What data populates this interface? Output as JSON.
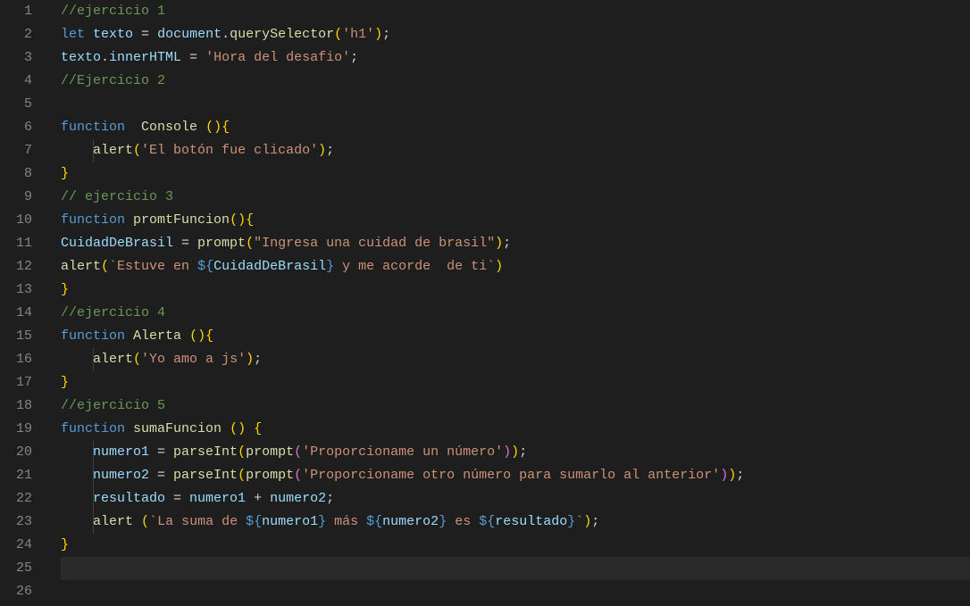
{
  "editor": {
    "lineCount": 26,
    "activeLine": 25,
    "tokens": {
      "l1": [
        [
          "comment",
          "//ejercicio 1"
        ]
      ],
      "l2": [
        [
          "keyword",
          "let"
        ],
        [
          "",
          ""
        ],
        [
          "op",
          " "
        ],
        [
          "var",
          "texto"
        ],
        [
          "op",
          " = "
        ],
        [
          "var",
          "document"
        ],
        [
          "punc",
          "."
        ],
        [
          "func",
          "querySelector"
        ],
        [
          "brace",
          "("
        ],
        [
          "string",
          "'h1'"
        ],
        [
          "brace",
          ")"
        ],
        [
          "punc",
          ";"
        ]
      ],
      "l3": [
        [
          "var",
          "texto"
        ],
        [
          "punc",
          "."
        ],
        [
          "prop",
          "innerHTML"
        ],
        [
          "op",
          " = "
        ],
        [
          "string",
          "'Hora del desafio'"
        ],
        [
          "punc",
          ";"
        ]
      ],
      "l4": [
        [
          "comment",
          "//Ejercicio 2"
        ]
      ],
      "l5": [],
      "l6": [
        [
          "keyword",
          "function"
        ],
        [
          "op",
          "  "
        ],
        [
          "func",
          "Console"
        ],
        [
          "op",
          " "
        ],
        [
          "brace",
          "()"
        ],
        [
          "brace",
          "{"
        ]
      ],
      "l7": [
        [
          "op",
          "    "
        ],
        [
          "func",
          "alert"
        ],
        [
          "brace",
          "("
        ],
        [
          "string",
          "'El botón fue clicado'"
        ],
        [
          "brace",
          ")"
        ],
        [
          "punc",
          ";"
        ]
      ],
      "l8": [
        [
          "brace",
          "}"
        ]
      ],
      "l9": [
        [
          "comment",
          "// ejercicio 3"
        ]
      ],
      "l10": [
        [
          "keyword",
          "function"
        ],
        [
          "op",
          " "
        ],
        [
          "func",
          "promtFuncion"
        ],
        [
          "brace",
          "()"
        ],
        [
          "brace",
          "{"
        ]
      ],
      "l11": [
        [
          "var",
          "CuidadDeBrasil"
        ],
        [
          "op",
          " = "
        ],
        [
          "func",
          "prompt"
        ],
        [
          "brace",
          "("
        ],
        [
          "string",
          "\"Ingresa una cuidad de brasil\""
        ],
        [
          "brace",
          ")"
        ],
        [
          "punc",
          ";"
        ]
      ],
      "l12": [
        [
          "func",
          "alert"
        ],
        [
          "brace",
          "("
        ],
        [
          "string",
          "`Estuve en "
        ],
        [
          "tplexpr",
          "${"
        ],
        [
          "tplvar",
          "CuidadDeBrasil"
        ],
        [
          "tplexpr",
          "}"
        ],
        [
          "string",
          " y me acorde  de ti`"
        ],
        [
          "brace",
          ")"
        ]
      ],
      "l13": [
        [
          "brace",
          "}"
        ]
      ],
      "l14": [
        [
          "comment",
          "//ejercicio 4"
        ]
      ],
      "l15": [
        [
          "keyword",
          "function"
        ],
        [
          "op",
          " "
        ],
        [
          "func",
          "Alerta"
        ],
        [
          "op",
          " "
        ],
        [
          "brace",
          "()"
        ],
        [
          "brace",
          "{"
        ]
      ],
      "l16": [
        [
          "op",
          "    "
        ],
        [
          "func",
          "alert"
        ],
        [
          "brace",
          "("
        ],
        [
          "string",
          "'Yo amo a js'"
        ],
        [
          "brace",
          ")"
        ],
        [
          "punc",
          ";"
        ]
      ],
      "l17": [
        [
          "brace",
          "}"
        ]
      ],
      "l18": [
        [
          "comment",
          "//ejercicio 5"
        ]
      ],
      "l19": [
        [
          "keyword",
          "function"
        ],
        [
          "op",
          " "
        ],
        [
          "func",
          "sumaFuncion"
        ],
        [
          "op",
          " "
        ],
        [
          "brace",
          "()"
        ],
        [
          "op",
          " "
        ],
        [
          "brace",
          "{"
        ]
      ],
      "l20": [
        [
          "op",
          "    "
        ],
        [
          "var",
          "numero1"
        ],
        [
          "op",
          " = "
        ],
        [
          "func",
          "parseInt"
        ],
        [
          "brace",
          "("
        ],
        [
          "func",
          "prompt"
        ],
        [
          "brace2",
          "("
        ],
        [
          "string",
          "'Proporcioname un número'"
        ],
        [
          "brace2",
          ")"
        ],
        [
          "brace",
          ")"
        ],
        [
          "punc",
          ";"
        ]
      ],
      "l21": [
        [
          "op",
          "    "
        ],
        [
          "var",
          "numero2"
        ],
        [
          "op",
          " = "
        ],
        [
          "func",
          "parseInt"
        ],
        [
          "brace",
          "("
        ],
        [
          "func",
          "prompt"
        ],
        [
          "brace2",
          "("
        ],
        [
          "string",
          "'Proporcioname otro número para sumarlo al anterior'"
        ],
        [
          "brace2",
          ")"
        ],
        [
          "brace",
          ")"
        ],
        [
          "punc",
          ";"
        ]
      ],
      "l22": [
        [
          "op",
          "    "
        ],
        [
          "var",
          "resultado"
        ],
        [
          "op",
          " = "
        ],
        [
          "var",
          "numero1"
        ],
        [
          "op",
          " + "
        ],
        [
          "var",
          "numero2"
        ],
        [
          "punc",
          ";"
        ]
      ],
      "l23": [
        [
          "op",
          "    "
        ],
        [
          "func",
          "alert"
        ],
        [
          "op",
          " "
        ],
        [
          "brace",
          "("
        ],
        [
          "string",
          "`La suma de "
        ],
        [
          "tplexpr",
          "${"
        ],
        [
          "tplvar",
          "numero1"
        ],
        [
          "tplexpr",
          "}"
        ],
        [
          "string",
          " más "
        ],
        [
          "tplexpr",
          "${"
        ],
        [
          "tplvar",
          "numero2"
        ],
        [
          "tplexpr",
          "}"
        ],
        [
          "string",
          " es "
        ],
        [
          "tplexpr",
          "${"
        ],
        [
          "tplvar",
          "resultado"
        ],
        [
          "tplexpr",
          "}"
        ],
        [
          "string",
          "`"
        ],
        [
          "brace",
          ")"
        ],
        [
          "punc",
          ";"
        ]
      ],
      "l24": [
        [
          "brace",
          "}"
        ]
      ],
      "l25": [],
      "l26": []
    },
    "indentGuides": {
      "7": [
        36
      ],
      "16": [
        36
      ],
      "20": [
        36
      ],
      "21": [
        36
      ],
      "22": [
        36
      ],
      "23": [
        36
      ]
    }
  }
}
